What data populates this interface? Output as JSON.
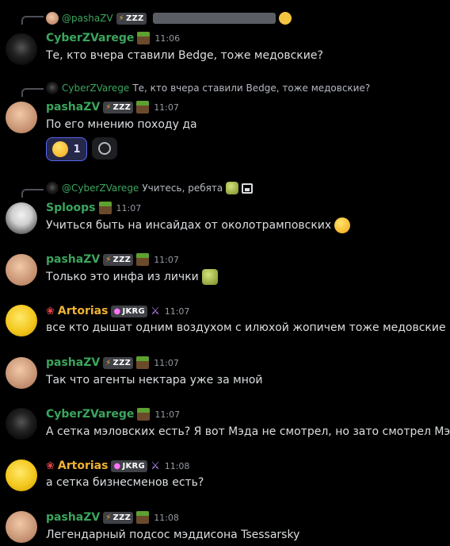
{
  "messages": [
    {
      "reply": {
        "name": "@pashaZV",
        "tag": "ZZZ"
      },
      "author": "CyberZVarege",
      "time": "11:06",
      "text": "Те, кто вчера ставили Bedge, тоже медовские?"
    },
    {
      "reply": {
        "name": "CyberZVarege",
        "text": "Те, кто вчера ставили Bedge, тоже медовские?"
      },
      "author": "pashaZV",
      "tag": "ZZZ",
      "time": "11:07",
      "text": "По его мнению походу да",
      "reaction": {
        "count": "1"
      }
    },
    {
      "reply": {
        "name": "@CyberZVarege",
        "text": "Учитесь, ребята"
      },
      "author": "Sploops",
      "time": "11:07",
      "text": "Учиться быть на инсайдах от околотрамповских"
    },
    {
      "author": "pashaZV",
      "tag": "ZZZ",
      "time": "11:07",
      "text": "Только это инфа из лички"
    },
    {
      "author": "Artorias",
      "tag": "JKRG",
      "time": "11:07",
      "text": "все кто дышат одним воздухом с илюхой жопичем тоже медовские"
    },
    {
      "author": "pashaZV",
      "tag": "ZZZ",
      "time": "11:07",
      "text": "Так что агенты нектара уже за мной"
    },
    {
      "author": "CyberZVarege",
      "time": "11:07",
      "text": "А сетка мэловских есть? Я вот Мэда не смотрел, но зато смотрел Мэла"
    },
    {
      "author": "Artorias",
      "tag": "JKRG",
      "time": "11:08",
      "text": "а сетка бизнесменов есть?"
    },
    {
      "author": "pashaZV",
      "tag": "ZZZ",
      "time": "11:08",
      "text": "Легендарный подсос мэддисона Tsessarsky"
    }
  ],
  "colors": {
    "background": "#000000",
    "green_name": "#3ba55d",
    "orange_name": "#f0b232",
    "reaction_border": "#5865f2"
  }
}
